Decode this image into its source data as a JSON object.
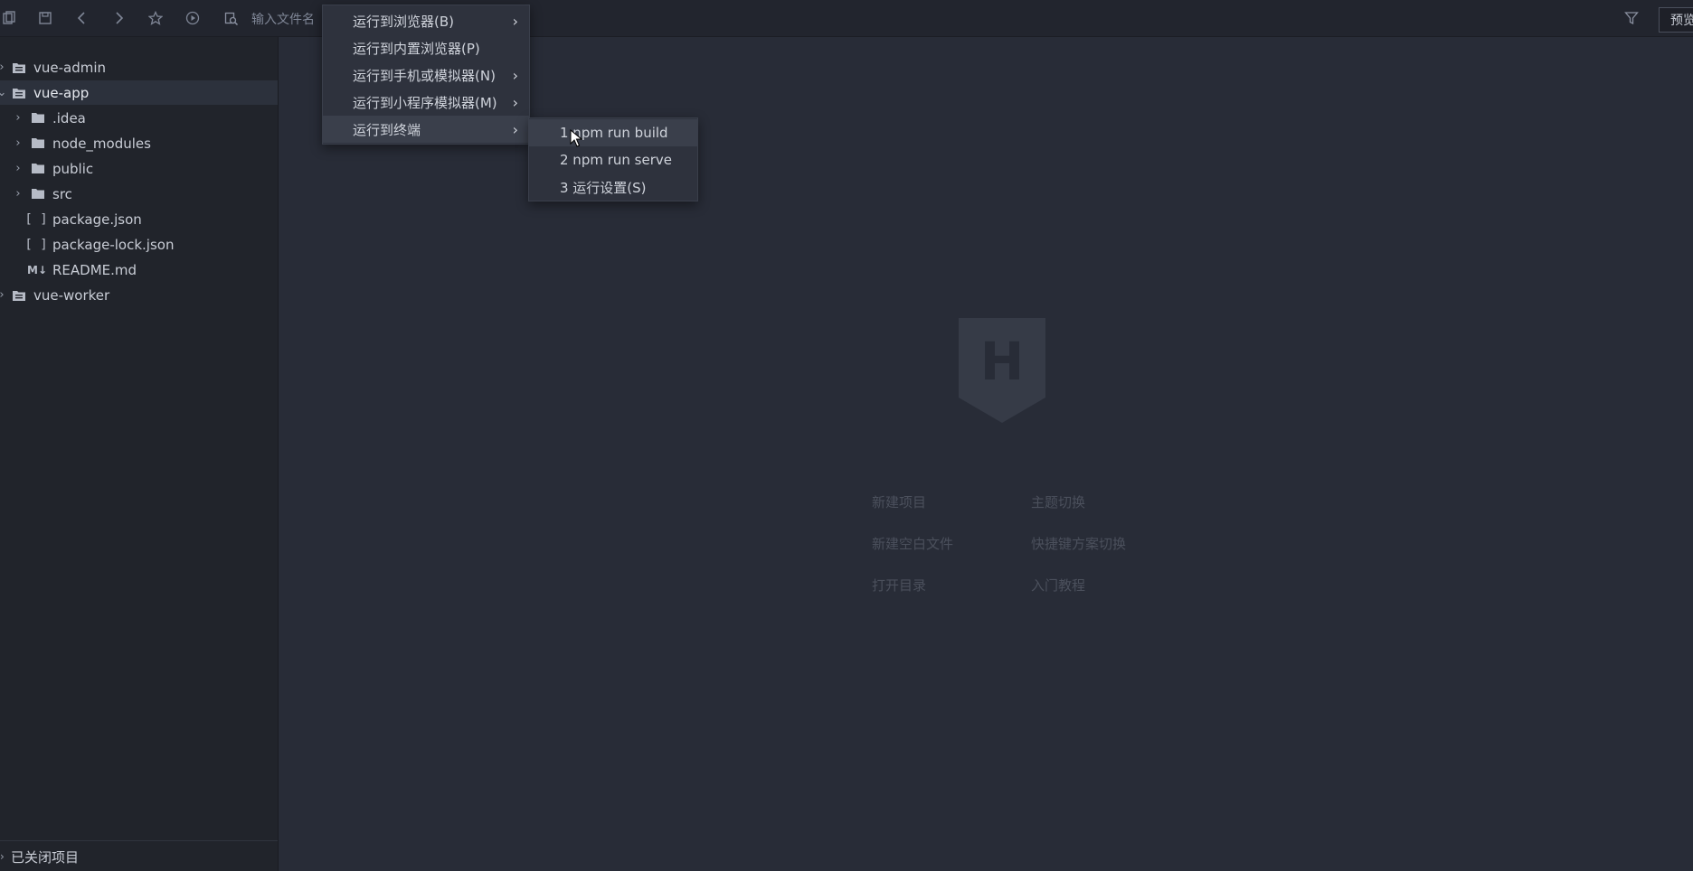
{
  "toolbar": {
    "search_placeholder": "输入文件名",
    "preview_label": "预览",
    "icons": [
      "copy-icon",
      "save-icon",
      "back-icon",
      "forward-icon",
      "star-icon",
      "run-icon",
      "search-file-icon",
      "filter-icon"
    ]
  },
  "sidebar": {
    "items": [
      {
        "label": "vue-admin",
        "type": "project",
        "expanded": false
      },
      {
        "label": "vue-app",
        "type": "project",
        "expanded": true,
        "selected": true
      },
      {
        "label": ".idea",
        "type": "folder"
      },
      {
        "label": "node_modules",
        "type": "folder"
      },
      {
        "label": "public",
        "type": "folder"
      },
      {
        "label": "src",
        "type": "folder"
      },
      {
        "label": "package.json",
        "type": "json"
      },
      {
        "label": "package-lock.json",
        "type": "json"
      },
      {
        "label": "README.md",
        "type": "markdown"
      },
      {
        "label": "vue-worker",
        "type": "project",
        "expanded": false
      }
    ],
    "closed_projects_label": "已关闭项目"
  },
  "welcome": {
    "logo_letter": "H",
    "links": {
      "new_project": "新建项目",
      "theme_switch": "主题切换",
      "new_blank_file": "新建空白文件",
      "shortcut_switch": "快捷键方案切换",
      "open_directory": "打开目录",
      "tutorial": "入门教程"
    }
  },
  "run_menu": {
    "items": [
      {
        "label": "运行到浏览器(B)",
        "has_submenu": true
      },
      {
        "label": "运行到内置浏览器(P)",
        "has_submenu": false
      },
      {
        "label": "运行到手机或模拟器(N)",
        "has_submenu": true
      },
      {
        "label": "运行到小程序模拟器(M)",
        "has_submenu": true
      },
      {
        "label": "运行到终端",
        "has_submenu": true,
        "active": true
      }
    ]
  },
  "terminal_submenu": {
    "items": [
      {
        "label": "1 npm run build",
        "hover": true
      },
      {
        "label": "2 npm run serve"
      },
      {
        "label": "3 运行设置(S)"
      }
    ]
  },
  "colors": {
    "editor_bg": "#282c37",
    "sidebar_bg": "#21242b",
    "menu_bg": "#2e323d",
    "menu_hover": "#3a3f4b",
    "welcome_text": "#4b505c"
  }
}
